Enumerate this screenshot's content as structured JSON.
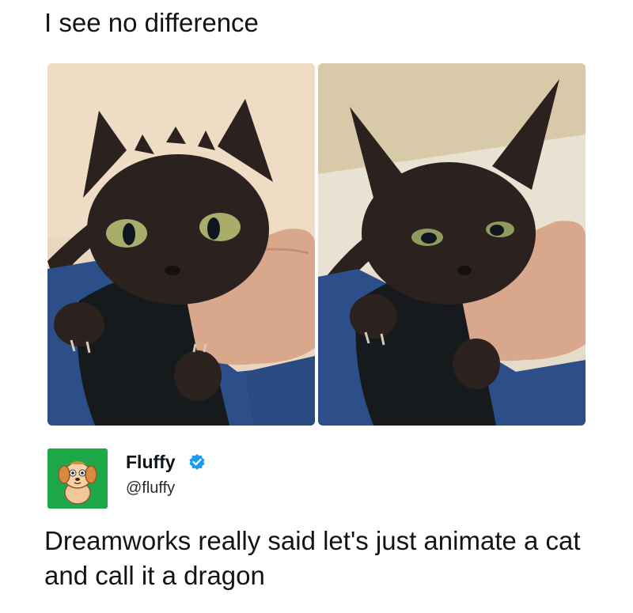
{
  "meme": {
    "top_caption": "I see no difference"
  },
  "images": [
    {
      "name": "dragon-cat-image",
      "icon": "cat-dragon-edit"
    },
    {
      "name": "cat-image",
      "icon": "black-cat"
    }
  ],
  "post": {
    "author_name": "Fluffy",
    "author_handle": "@fluffy",
    "avatar_icon": "cartoon-dog-avatar",
    "verified_icon": "verified-badge",
    "avatar_bg": "#1ea84a",
    "verified_color": "#1d9bf0",
    "text": "Dreamworks really said let's just animate a cat and call it a dragon"
  }
}
